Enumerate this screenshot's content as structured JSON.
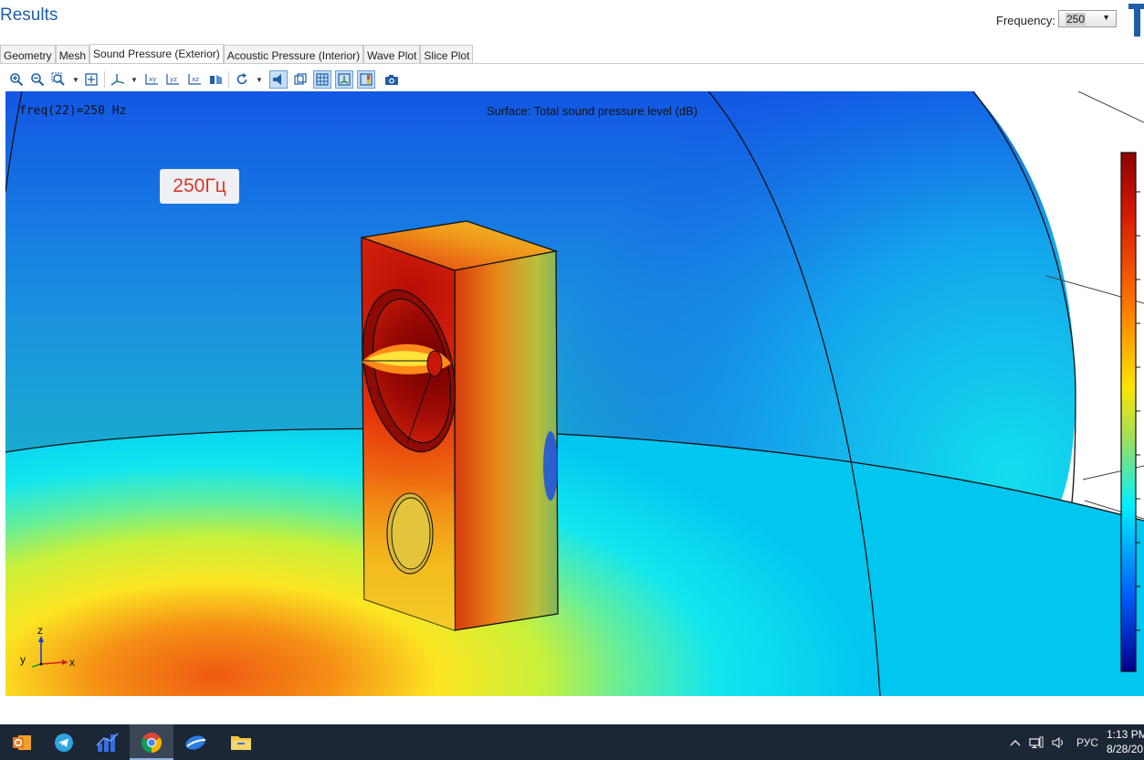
{
  "header": {
    "title": "Results"
  },
  "frequency": {
    "label": "Frequency:",
    "value": "250"
  },
  "tabs": [
    {
      "label": "Geometry"
    },
    {
      "label": "Mesh"
    },
    {
      "label": "Sound Pressure (Exterior)",
      "active": true
    },
    {
      "label": "Acoustic Pressure (Interior)"
    },
    {
      "label": "Wave Plot"
    },
    {
      "label": "Slice Plot"
    }
  ],
  "toolbar": {
    "icons": [
      "zoom-in-icon",
      "zoom-out-icon",
      "zoom-box-icon",
      "zoom-extents-icon",
      "axes-view-icon",
      "xy-view-icon",
      "yz-view-icon",
      "xz-view-icon",
      "scene-light-icon",
      "reset-rotation-icon",
      "transparency-icon",
      "wireframe-icon",
      "grid-icon",
      "axis-orientation-icon",
      "color-legend-icon",
      "camera-icon"
    ]
  },
  "plot": {
    "freq_text": "freq(22)=250 Hz",
    "surface_title": "Surface: Total sound pressure level (dB)",
    "annotation": "250Гц",
    "axes": {
      "z": "z",
      "y": "y",
      "x": "x"
    },
    "colormap": [
      "#8b0000",
      "#d62000",
      "#ff7a00",
      "#ffe000",
      "#9fe05a",
      "#00f0ff",
      "#0060ff",
      "#00008b"
    ]
  },
  "taskbar": {
    "apps": [
      "outlook-icon",
      "telegram-icon",
      "analytics-icon",
      "chrome-icon",
      "edge-swoosh-icon",
      "file-explorer-icon"
    ],
    "language": "РУС",
    "time": "1:13 PM",
    "date": "8/28/20"
  }
}
